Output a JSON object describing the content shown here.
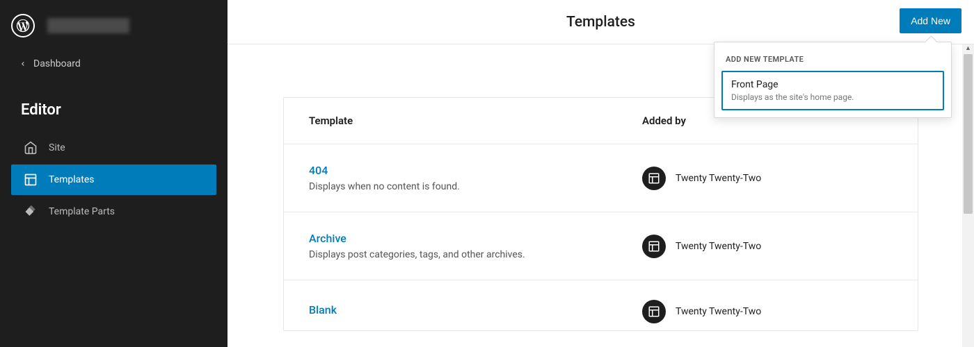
{
  "sidebar": {
    "dashboard_label": "Dashboard",
    "editor_label": "Editor",
    "items": [
      {
        "label": "Site"
      },
      {
        "label": "Templates"
      },
      {
        "label": "Template Parts"
      }
    ]
  },
  "header": {
    "title": "Templates",
    "add_new_label": "Add New"
  },
  "table": {
    "col_template": "Template",
    "col_added_by": "Added by",
    "rows": [
      {
        "name": "404",
        "desc": "Displays when no content is found.",
        "added_by": "Twenty Twenty-Two"
      },
      {
        "name": "Archive",
        "desc": "Displays post categories, tags, and other archives.",
        "added_by": "Twenty Twenty-Two"
      },
      {
        "name": "Blank",
        "desc": "",
        "added_by": "Twenty Twenty-Two"
      }
    ]
  },
  "popover": {
    "title": "ADD NEW TEMPLATE",
    "option_title": "Front Page",
    "option_desc": "Displays as the site's home page."
  }
}
